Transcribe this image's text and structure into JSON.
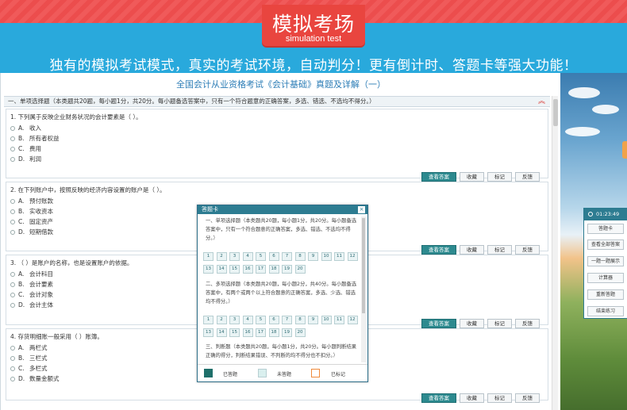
{
  "header": {
    "title": "模拟考场",
    "subtitle": "simulation test",
    "slogan": "独有的模拟考试模式，真实的考试环境，自动判分！更有倒计时、答题卡等强大功能！"
  },
  "exam": {
    "title": "全国会计从业资格考试《会计基础》真题及详解（一）",
    "section_header": "一、单项选择题（本类题共20题，每小题1分，共20分。每小题备选答案中，只有一个符合题意的正确答案，多选、错选、不选均不得分。）",
    "buttons": {
      "view_answer": "查看答案",
      "favorite": "收藏",
      "mark": "标记",
      "feedback": "反馈"
    },
    "questions": [
      {
        "text": "1. 下列属于反映企业财务状况的会计要素是（    ）。",
        "options": [
          {
            "letter": "A.",
            "text": "收入"
          },
          {
            "letter": "B.",
            "text": "所有者权益"
          },
          {
            "letter": "C.",
            "text": "费用"
          },
          {
            "letter": "D.",
            "text": "利润"
          }
        ]
      },
      {
        "text": "2. 在下列账户中，按照反映的经济内容设置的账户是（    ）。",
        "options": [
          {
            "letter": "A.",
            "text": "预付账款"
          },
          {
            "letter": "B.",
            "text": "实收资本"
          },
          {
            "letter": "C.",
            "text": "固定资产"
          },
          {
            "letter": "D.",
            "text": "短期借款"
          }
        ]
      },
      {
        "text": "3. （    ）是账户的名称，也是设置账户的依据。",
        "options": [
          {
            "letter": "A.",
            "text": "会计科目"
          },
          {
            "letter": "B.",
            "text": "会计要素"
          },
          {
            "letter": "C.",
            "text": "会计对象"
          },
          {
            "letter": "D.",
            "text": "会计主体"
          }
        ]
      },
      {
        "text": "4. 存货明细账一般采用（    ）账簿。",
        "options": [
          {
            "letter": "A.",
            "text": "两栏式"
          },
          {
            "letter": "B.",
            "text": "三栏式"
          },
          {
            "letter": "C.",
            "text": "多栏式"
          },
          {
            "letter": "D.",
            "text": "数量金额式"
          }
        ]
      }
    ]
  },
  "answer_sheet": {
    "title": "答题卡",
    "close": "×",
    "sections": [
      {
        "text": "一、单项选择题（本类题共20题，每小题1分，共20分。每小题备选答案中，只有一个符合题意的正确答案，多选、错选、不选均不得分。）",
        "numbers": [
          "1",
          "2",
          "3",
          "4",
          "5",
          "6",
          "7",
          "8",
          "9",
          "10",
          "11",
          "12",
          "13",
          "14",
          "15",
          "16",
          "17",
          "18",
          "19",
          "20"
        ]
      },
      {
        "text": "二、多项选择题（本类题共20题，每小题2分，共40分。每小题备选答案中，有两个或两个以上符合题意的正确答案，多选、少选、错选均不得分。）",
        "numbers": [
          "1",
          "2",
          "3",
          "4",
          "5",
          "6",
          "7",
          "8",
          "9",
          "10",
          "11",
          "12",
          "13",
          "14",
          "15",
          "16",
          "17",
          "18",
          "19",
          "20"
        ]
      },
      {
        "text": "三、判断题（本类题共20题，每小题1分，共20分。每小题判断结果正确的得分，判断结果错误、不判断的均不得分也不扣分。）",
        "numbers": []
      }
    ],
    "legend": {
      "answered": "已答题",
      "unanswered": "未答题",
      "marked": "已标记"
    },
    "colors": {
      "answered": "#1e6f6a",
      "unanswered": "#d9efee",
      "marked": "#f08a3a"
    }
  },
  "tools": {
    "timer": "01:23:49",
    "buttons": [
      "答题卡",
      "查看全部答案",
      "一题一题展示",
      "计算器",
      "重新答题",
      "结束练习"
    ]
  }
}
